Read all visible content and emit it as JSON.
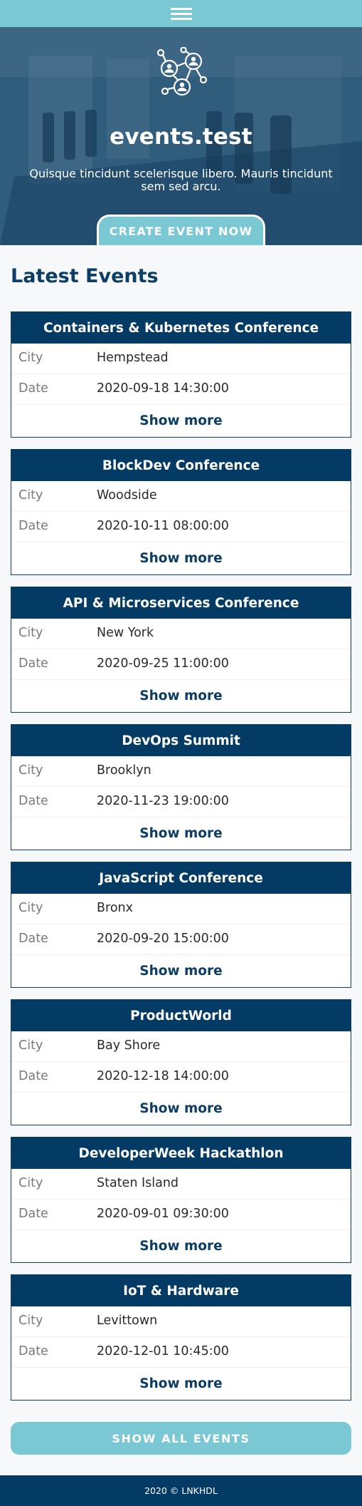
{
  "topbar": {
    "menu_icon": "hamburger-icon"
  },
  "hero": {
    "logo_icon": "people-network-icon",
    "title": "events.test",
    "subtitle": "Quisque tincidunt scelerisque libero. Mauris tincidunt sem sed arcu.",
    "cta_label": "CREATE EVENT NOW"
  },
  "latest": {
    "heading": "Latest Events",
    "city_label": "City",
    "date_label": "Date",
    "more_label": "Show more",
    "events": [
      {
        "title": "Containers & Kubernetes Conference",
        "city": "Hempstead",
        "date": "2020-09-18 14:30:00"
      },
      {
        "title": "BlockDev Conference",
        "city": "Woodside",
        "date": "2020-10-11 08:00:00"
      },
      {
        "title": "API & Microservices Conference",
        "city": "New York",
        "date": "2020-09-25 11:00:00"
      },
      {
        "title": "DevOps Summit",
        "city": "Brooklyn",
        "date": "2020-11-23 19:00:00"
      },
      {
        "title": "JavaScript Conference",
        "city": "Bronx",
        "date": "2020-09-20 15:00:00"
      },
      {
        "title": "ProductWorld",
        "city": "Bay Shore",
        "date": "2020-12-18 14:00:00"
      },
      {
        "title": "DeveloperWeek Hackathlon",
        "city": "Staten Island",
        "date": "2020-09-01 09:30:00"
      },
      {
        "title": "IoT & Hardware",
        "city": "Levittown",
        "date": "2020-12-01 10:45:00"
      }
    ],
    "show_all_label": "SHOW ALL EVENTS"
  },
  "footer": {
    "text": "2020 © LNKHDL"
  },
  "colors": {
    "accent": "#79c8d3",
    "primary": "#033b65"
  }
}
